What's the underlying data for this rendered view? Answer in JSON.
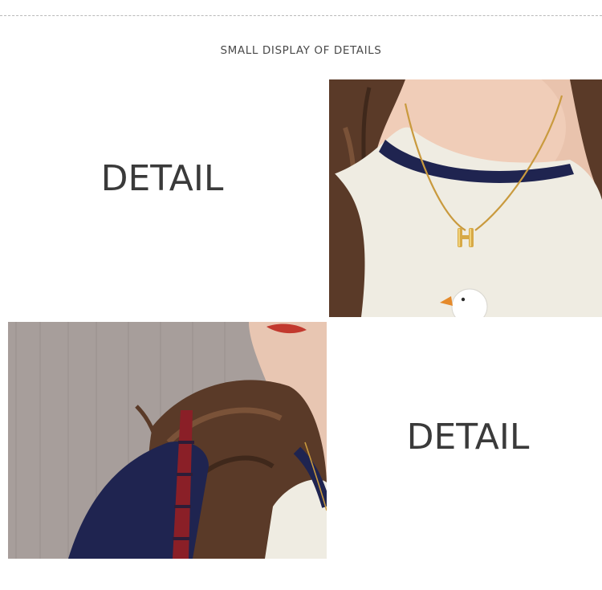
{
  "section": {
    "heading": "SMALL DISPLAY OF DETAILS"
  },
  "panels": {
    "top_left_label": "DETAIL",
    "bottom_right_label": "DETAIL"
  },
  "colors": {
    "heading_text": "#4a4a4a",
    "detail_text": "#3a3a3a",
    "shirt_cream": "#efece2",
    "collar_navy": "#1f2450",
    "hair_brown": "#5a3a28",
    "necklace_gold": "#c99a3e",
    "lip_red": "#c2392e",
    "wall_gray": "#a79e9b"
  }
}
